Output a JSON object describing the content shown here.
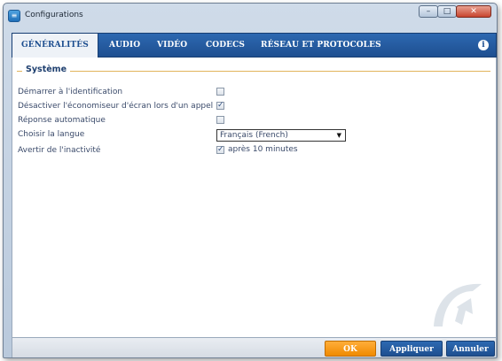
{
  "window": {
    "title": "Configurations"
  },
  "tabs": [
    {
      "label": "GÉNÉRALITÉS",
      "active": true
    },
    {
      "label": "AUDIO"
    },
    {
      "label": "VIDÉO"
    },
    {
      "label": "CODECS"
    },
    {
      "label": "RÉSEAU ET PROTOCOLES"
    }
  ],
  "section": {
    "title": "Système"
  },
  "settings": {
    "start_on_login": {
      "label": "Démarrer à l'identification",
      "checked": false
    },
    "disable_screensaver": {
      "label": "Désactiver l'économiseur d'écran lors d'un appel",
      "checked": true
    },
    "auto_answer": {
      "label": "Réponse automatique",
      "checked": false
    },
    "language": {
      "label": "Choisir la langue",
      "value": "Français (French)"
    },
    "idle_warning": {
      "label": "Avertir de l'inactivité",
      "checked": true,
      "prefix": "après",
      "value": "10",
      "unit": "minutes"
    }
  },
  "buttons": {
    "ok": "OK",
    "apply": "Appliquer",
    "cancel": "Annuler"
  },
  "icons": {
    "info": "info-icon",
    "app": "app-icon",
    "watermark": "brand-logo"
  },
  "colors": {
    "tab_bar": "#1e4f90",
    "ok_button": "#f08a00",
    "section_line": "#e2b45b"
  }
}
